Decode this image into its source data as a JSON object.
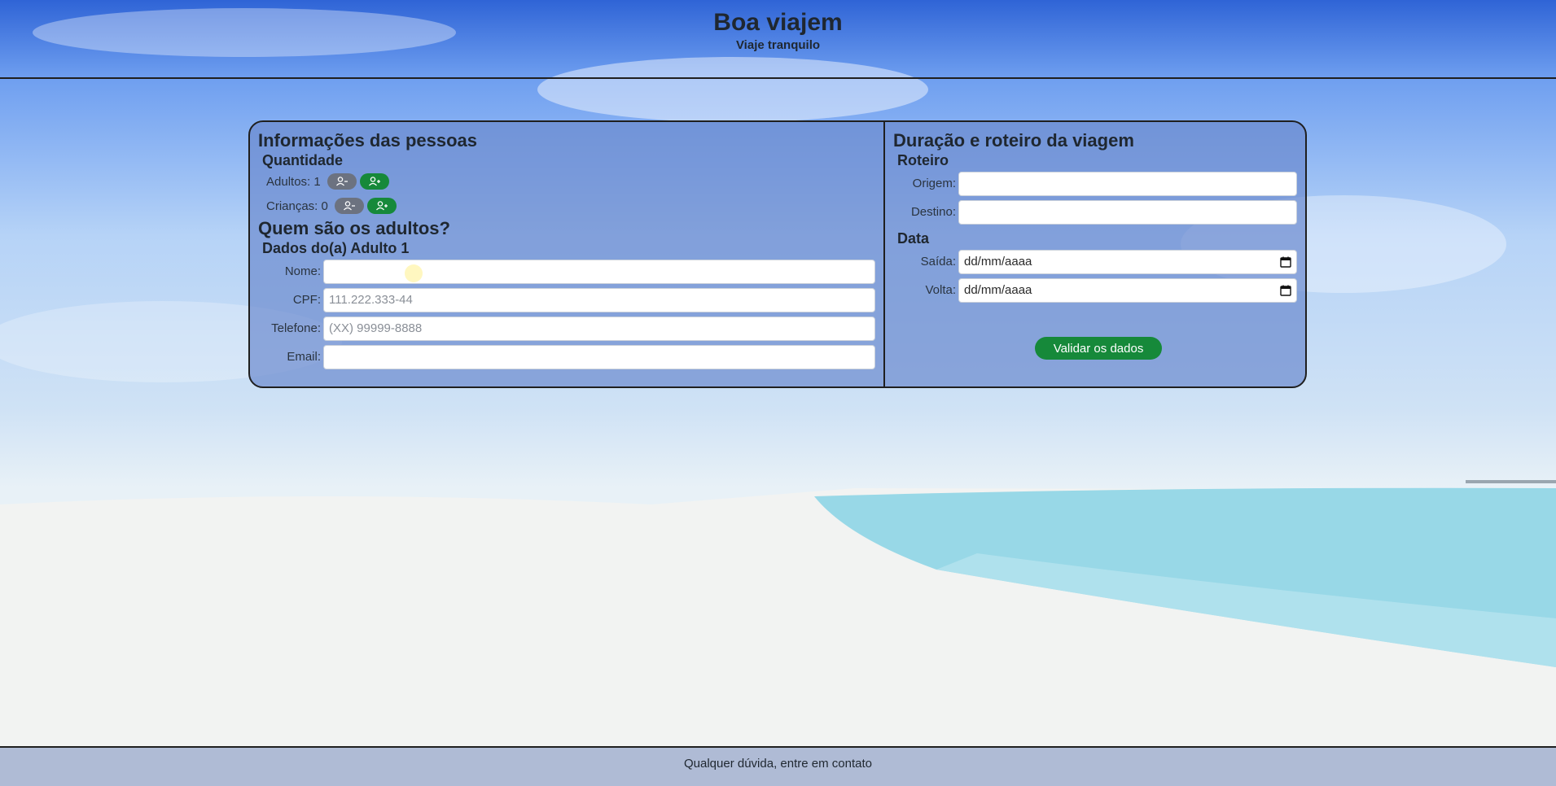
{
  "header": {
    "title": "Boa viajem",
    "subtitle": "Viaje tranquilo"
  },
  "people": {
    "title": "Informações das pessoas",
    "quantity_heading": "Quantidade",
    "adults_label": "Adultos: 1",
    "children_label": "Crianças: 0",
    "adults_question": "Quem são os adultos?",
    "adult_heading": "Dados do(a) Adulto 1",
    "fields": {
      "name_label": "Nome:",
      "cpf_label": "CPF:",
      "cpf_placeholder": "111.222.333-44",
      "phone_label": "Telefone:",
      "phone_placeholder": "(XX) 99999-8888",
      "email_label": "Email:"
    },
    "icons": {
      "remove": "user-minus-icon",
      "add": "user-plus-icon"
    }
  },
  "trip": {
    "title": "Duração e roteiro da viagem",
    "route_heading": "Roteiro",
    "origin_label": "Origem:",
    "destination_label": "Destino:",
    "date_heading": "Data",
    "departure_label": "Saída:",
    "departure_value": "dd/mm/aaaa",
    "return_label": "Volta:",
    "return_value": "dd/mm/aaaa",
    "validate_button": "Validar os dados"
  },
  "footer": {
    "text": "Qualquer dúvida, entre em contato"
  },
  "colors": {
    "green": "#16893a",
    "gray": "#6c7280",
    "card": "#6987cd"
  }
}
